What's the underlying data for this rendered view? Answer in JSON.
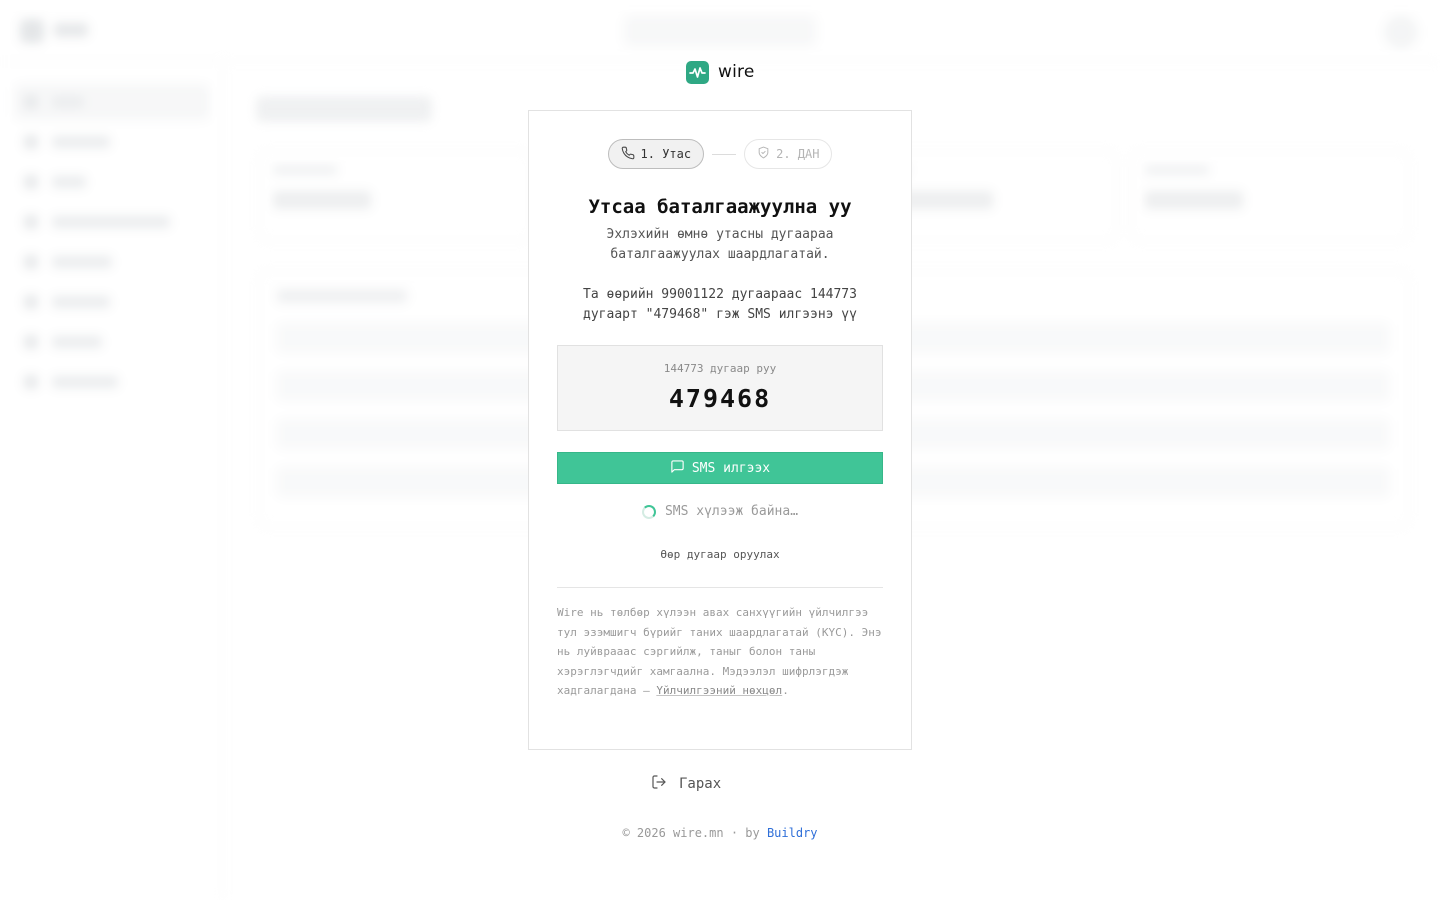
{
  "brand": {
    "name": "wire",
    "color": "#2fa884"
  },
  "steps": [
    {
      "label": "1. Утас",
      "icon": "phone-icon",
      "state": "active"
    },
    {
      "label": "2. ДАН",
      "icon": "shield-icon",
      "state": "inactive"
    }
  ],
  "verify": {
    "title": "Утсаа баталгаажуулна уу",
    "subtitle": "Эхлэхийн өмнө утасны дугаараа баталгаажуулах шаардлагатай.",
    "instruction": "Та өөрийн 99001122 дугаараас 144773 дугаарт \"479468\" гэж SMS илгээнэ үү",
    "code_label": "144773 дугаар руу",
    "code_value": "479468",
    "sms_button": "SMS илгээх",
    "waiting_text": "SMS хүлээж байна…",
    "other_number": "Өөр дугаар оруулах",
    "disclaimer_text": "Wire нь төлбөр хүлээн авах санхүүгийн үйлчилгээ тул эзэмшигч бүрийг таних шаардлагатай (KYC). Энэ нь луйврааас сэргийлж, таныг болон таны хэрэглэгчдийг хамгаална. Мэдээлэл шифрлэгдэж хадгалагдана — ",
    "terms_link": "Үйлчилгээний нөхцөл",
    "disclaimer_end": "."
  },
  "logout_label": "Гарах",
  "footer": {
    "text": "© 2026 wire.mn · by ",
    "credit": "Buildry"
  },
  "colors": {
    "accent": "#40c597",
    "link": "#2f6fd8"
  }
}
